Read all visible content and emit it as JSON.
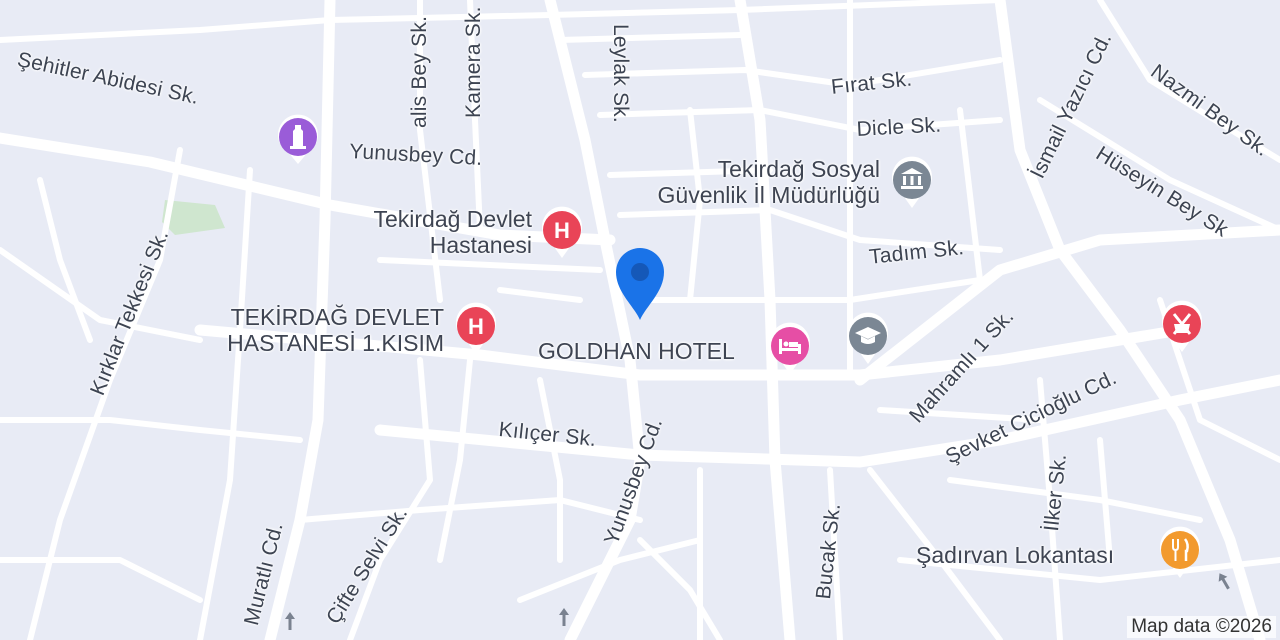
{
  "map": {
    "credit": "Map data ©2026",
    "colors": {
      "land": "#e8ebf5",
      "road": "#ffffff",
      "park": "#cfe6cf",
      "accent_pin": "#1a73e8"
    }
  },
  "streets": {
    "sehitler_abidesi": "Şehitler Abidesi Sk.",
    "yunusbey_cd_top": "Yunusbey Cd.",
    "yunusbey_cd_bottom": "Yunusbey Cd.",
    "leylak": "Leylak Sk.",
    "kamera": "Kamera Sk.",
    "alis_bey": "alis Bey Sk.",
    "firat": "Fırat Sk.",
    "dicle": "Dicle Sk.",
    "tadim": "Tadım Sk.",
    "ismail_yazici": "İsmail Yazıcı Cd.",
    "nazmi_bey": "Nazmi Bey Sk.",
    "huseyin_bey": "Hüseyin Bey Sk",
    "kirklar_tekkesi": "Kırklar Tekkesi Sk.",
    "kilicer": "Kılıçer Sk.",
    "mahramli": "Mahramlı 1 Sk.",
    "sevket_ciciogLu": "Şevket Cicioğlu Cd.",
    "ilker": "İlker Sk.",
    "bucak": "Bucak Sk.",
    "muratli": "Muratlı Cd.",
    "cifte_selvi": "Çifte Selvi Sk."
  },
  "pois": {
    "hospital1_line1": "Tekirdağ Devlet",
    "hospital1_line2": "Hastanesi",
    "hospital2_line1": "TEKİRDAĞ DEVLET",
    "hospital2_line2": "HASTANESİ 1.KISIM",
    "ssk_line1": "Tekirdağ Sosyal",
    "ssk_line2": "Güvenlik İl Müdürlüğü",
    "hotel": "GOLDHAN HOTEL",
    "restaurant": "Şadırvan Lokantası",
    "hospital_letter": "H"
  }
}
